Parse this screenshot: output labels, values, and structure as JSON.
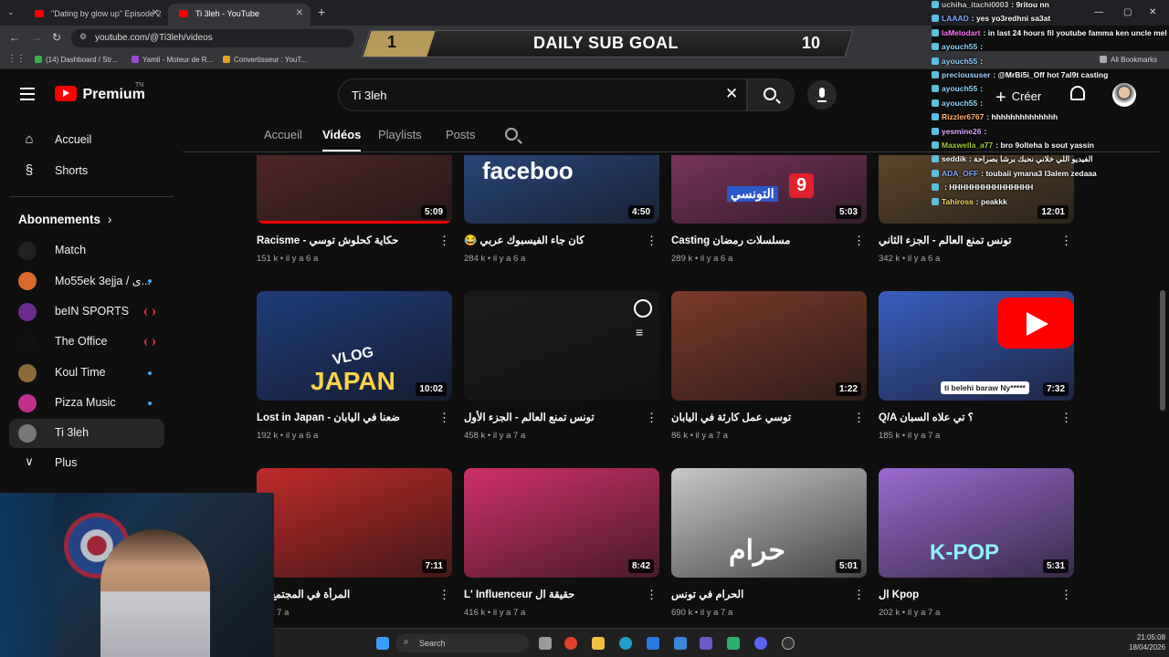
{
  "browser": {
    "tabs": [
      {
        "title": "\"Dating by glow up\" Episode 2",
        "active": false
      },
      {
        "title": "Ti 3leh - YouTube",
        "active": true
      }
    ],
    "new_tab": "+",
    "url": "youtube.com/@Ti3leh/videos",
    "bookmarks": [
      "(14) Dashboard / Str...",
      "Yamli - Moteur de R...",
      "Convertisseur : YouT..."
    ],
    "all_bookmarks": "All Bookmarks"
  },
  "overlay": {
    "goal_title": "DAILY SUB GOAL",
    "goal_start": "1",
    "goal_target": "10"
  },
  "chat": {
    "messages": [
      {
        "user": "uchiha_itachi0003",
        "text": "9ritou nn",
        "color": "#c9c9c9"
      },
      {
        "user": "LAAAD",
        "text": "yes yo3redhni sa3at",
        "color": "#7ea7ff"
      },
      {
        "user": "laMelodart",
        "text": "in last 24 hours fil youtube famma ken uncle mel mouch mafer",
        "color": "#ff77ff"
      },
      {
        "user": "ayouch55",
        "text": "",
        "color": "#8fd5ff"
      },
      {
        "user": "ayouch55",
        "text": "",
        "color": "#8fd5ff"
      },
      {
        "user": "precioususer",
        "text": "@MrBi5i_Off hot 7al9t casting",
        "color": "#9fd1ff"
      },
      {
        "user": "ayouch55",
        "text": "",
        "color": "#8fd5ff"
      },
      {
        "user": "ayouch55",
        "text": "",
        "color": "#8fd5ff"
      },
      {
        "user": "Rizzler6767",
        "text": "hhhhhhhhhhhhhh",
        "color": "#ffb36b"
      },
      {
        "user": "yesmine26",
        "text": "",
        "color": "#d9a8ff"
      },
      {
        "user": "Maxwella_a77",
        "text": "bro 9olteha b sout yassin",
        "color": "#9acd32"
      },
      {
        "user": "seddik",
        "text": "الفيديو اللي خلاني نحبك برشا بصراحة",
        "color": "#ffffff"
      },
      {
        "user": "ADA_OFF",
        "text": "toubaii ymana3 l3alem zedaaa",
        "color": "#7ea7ff"
      },
      {
        "user": "",
        "text": "HHHHHHHHHHHHHHH",
        "color": "#ff5c5c"
      },
      {
        "user": "Tahiross",
        "text": "peakkk",
        "color": "#ffd966"
      }
    ]
  },
  "youtube": {
    "logo_word": "Premium",
    "logo_region": "TN",
    "search_value": "Ti 3leh",
    "create_label": "Créer",
    "nav": [
      {
        "label": "Accueil",
        "icon": "home-icon"
      },
      {
        "label": "Shorts",
        "icon": "shorts-icon"
      }
    ],
    "subs_heading": "Abonnements",
    "subs_arrow": "›",
    "subscriptions": [
      {
        "name": "Match",
        "color": "#222",
        "indicator": "none"
      },
      {
        "name": "Mo55ek 3ejja / ی...",
        "color": "#d86b2a",
        "indicator": "dot"
      },
      {
        "name": "beIN SPORTS",
        "color": "#6a2c91",
        "indicator": "live"
      },
      {
        "name": "The Office",
        "color": "#111",
        "indicator": "live"
      },
      {
        "name": "Koul Time",
        "color": "#8a6a3a",
        "indicator": "dot"
      },
      {
        "name": "Pizza Music",
        "color": "#c0308a",
        "indicator": "dot"
      },
      {
        "name": "Ti 3leh",
        "color": "#777",
        "indicator": "none"
      }
    ],
    "more_label": "Plus",
    "channel_tabs": [
      "Accueil",
      "Vidéos",
      "Playlists",
      "Posts"
    ],
    "active_tab": "Vidéos",
    "videos": [
      {
        "title": "Racisme - حكاية كحلوش توسي",
        "meta": "151 k • il y a 6 a",
        "duration": "5:09",
        "bg": "#5a2a2a",
        "progress": 1.0
      },
      {
        "title": "😂 كان جاء الفيسبوك عربي",
        "meta": "284 k • il y a 6 a",
        "duration": "4:50",
        "bg": "#2c4f8a",
        "progress": 0.0
      },
      {
        "title": "Casting مسلسلات رمضان",
        "meta": "289 k • il y a 6 a",
        "duration": "5:03",
        "bg": "#8a3a6a",
        "progress": 0.0
      },
      {
        "title": "تونس تمنع العالم - الجزء الثاني",
        "meta": "342 k • il y a 6 a",
        "duration": "12:01",
        "bg": "#6a5030",
        "progress": 0.0
      },
      {
        "title": "Lost in Japan - ضعنا في اليابان",
        "meta": "192 k • il y a 6 a",
        "duration": "10:02",
        "bg": "#1f3c7a",
        "progress": 0.0
      },
      {
        "title": "تونس تمنع العالم - الجزء الأول",
        "meta": "458 k • il y a 7 a",
        "duration": "",
        "bg": "#1a1a1a",
        "progress": 0.0
      },
      {
        "title": "توسي عمل كارثة في اليابان",
        "meta": "86 k • il y a 7 a",
        "duration": "1:22",
        "bg": "#7a3a2a",
        "progress": 0.0
      },
      {
        "title": "Q/A ؟ تي علاه السبان",
        "meta": "185 k • il y a 7 a",
        "duration": "7:32",
        "bg": "#3a5ec0",
        "progress": 0.0
      },
      {
        "title": "المرأة في المجتمع ال",
        "meta": "il y a 7 a",
        "duration": "7:11",
        "bg": "#c02a2a",
        "progress": 0.0
      },
      {
        "title": "L' Influenceur حقيقة ال",
        "meta": "416 k • il y a 7 a",
        "duration": "8:42",
        "bg": "#d0306a",
        "progress": 0.0
      },
      {
        "title": "الحرام في تونس",
        "meta": "690 k • il y a 7 a",
        "duration": "5:01",
        "bg": "#c8c8c8",
        "progress": 0.0
      },
      {
        "title": "ال Kpop",
        "meta": "202 k • il y a 7 a",
        "duration": "5:31",
        "bg": "#9a6ad0",
        "progress": 0.0
      }
    ],
    "thumb_texts": {
      "facebook": "faceboo",
      "vlog": "VLOG",
      "japan": "JAPAN",
      "haram": "حرام",
      "kpop": "K-POP",
      "belehi": "ti belehi baraw Ny*****",
      "tunisie": "التونسي",
      "nine": "9"
    }
  },
  "taskbar": {
    "search_placeholder": "Search",
    "time": "21:05:08",
    "date": "18/04/2026"
  }
}
